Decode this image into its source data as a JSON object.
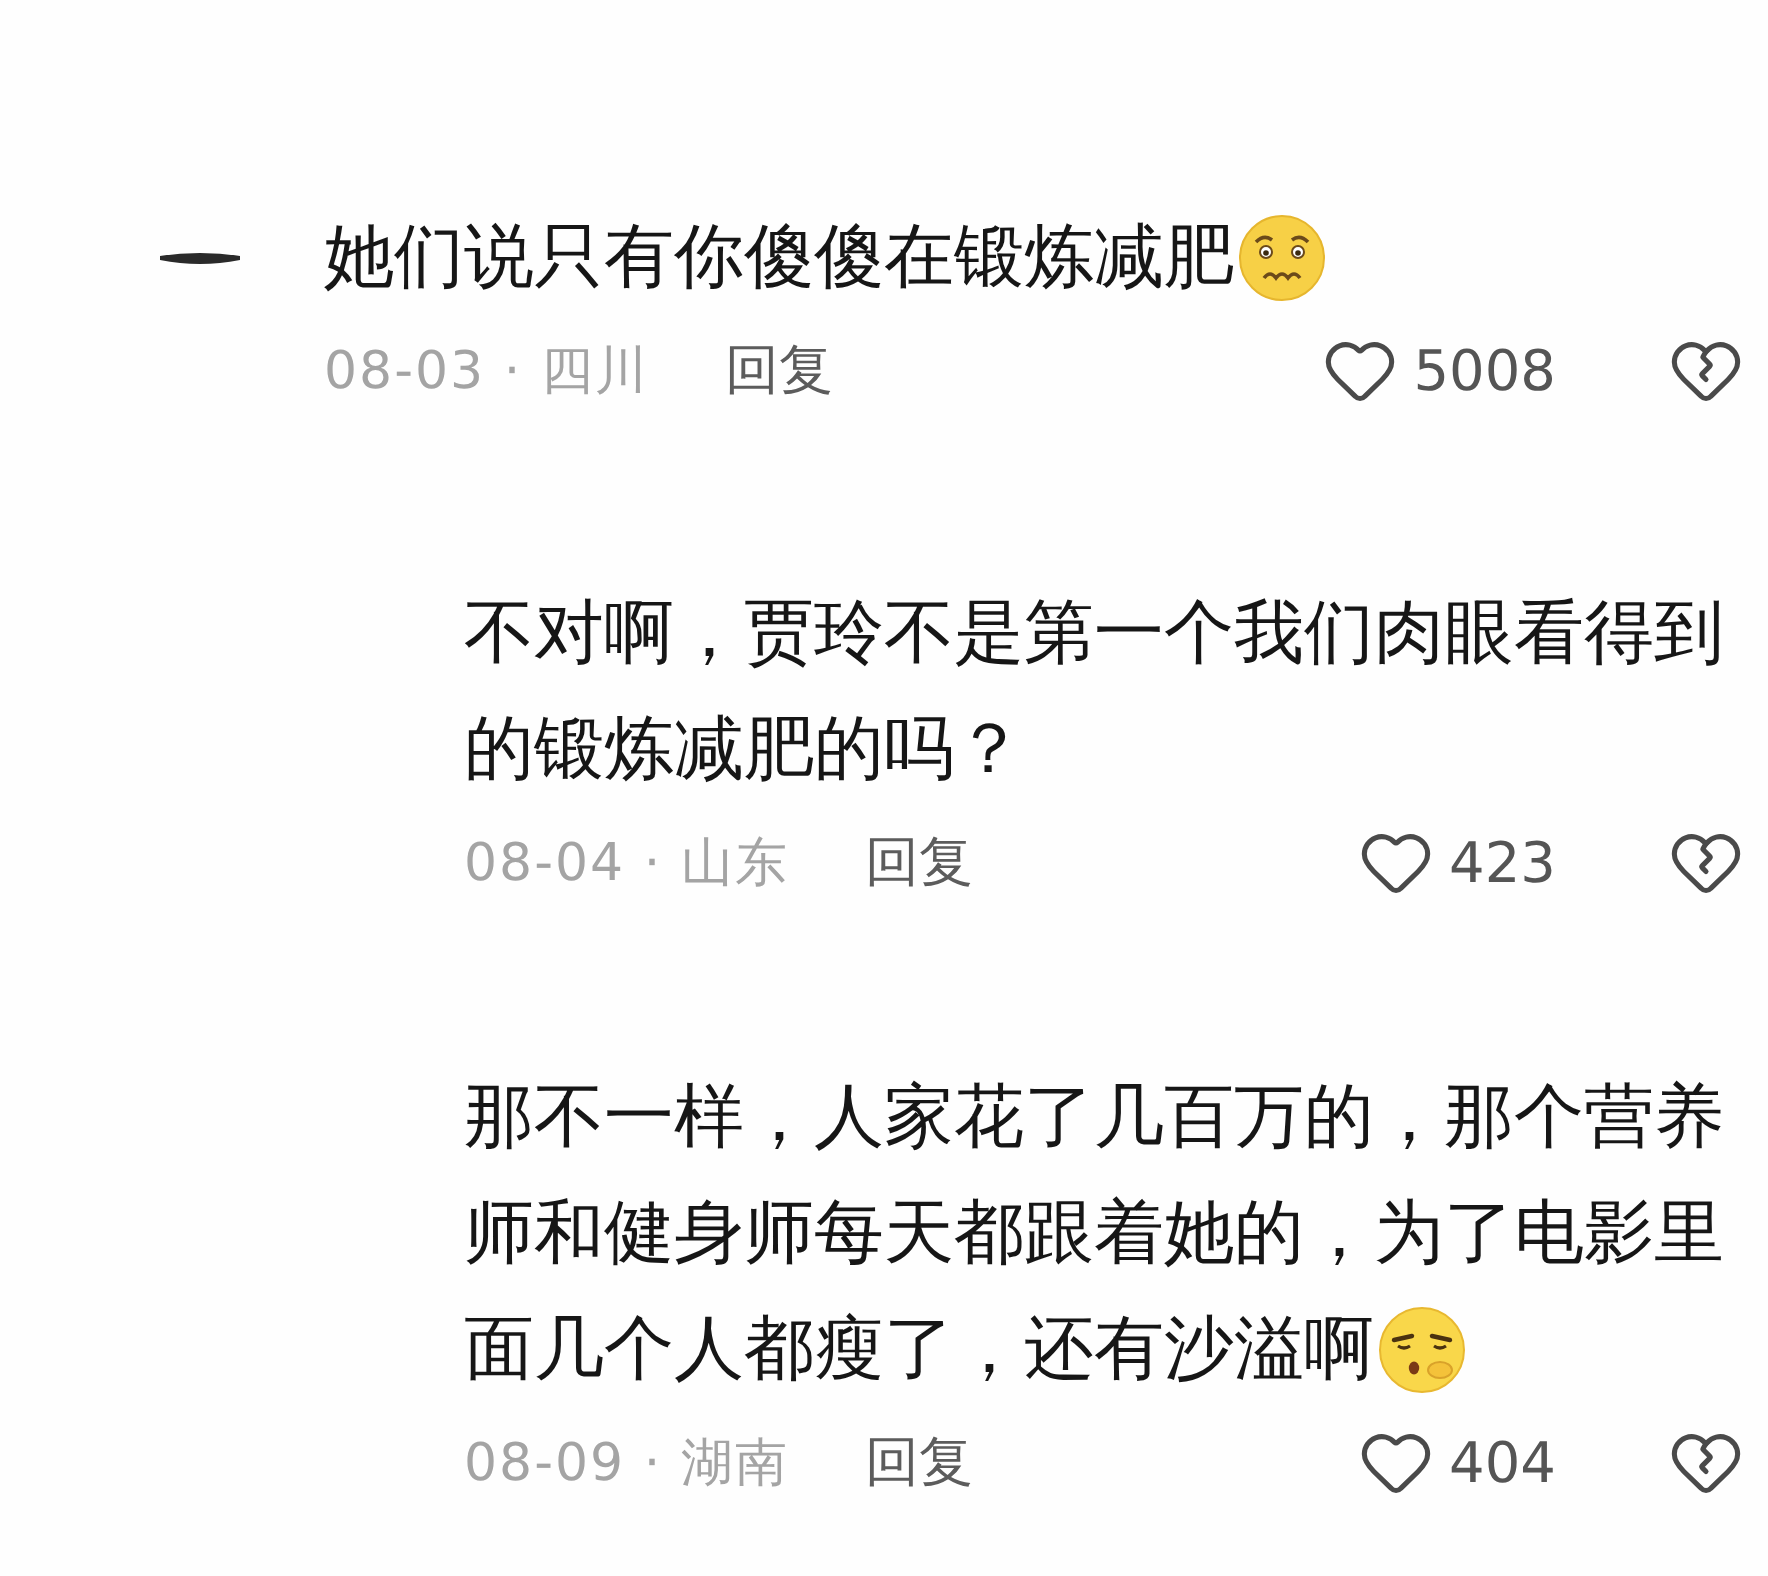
{
  "comments": [
    {
      "lines": [
        "她们说只有你傻傻在锻炼减肥"
      ],
      "emoji": {
        "kind": "worried"
      },
      "meta": "08-03 · 四川",
      "reply_label": "回复",
      "likes": "5008",
      "replies": [
        {
          "lines": [
            "不对啊，贾玲不是第一个我们肉眼看得到",
            "的锻炼减肥的吗？"
          ],
          "meta": "08-04 · 山东",
          "reply_label": "回复",
          "likes": "423"
        },
        {
          "lines": [
            "那不一样，人家花了几百万的，那个营养",
            "师和健身师每天都跟着她的，为了电影里",
            "面几个人都瘦了，还有沙溢啊"
          ],
          "emoji": {
            "kind": "sleepy"
          },
          "meta": "08-09 · 湖南",
          "reply_label": "回复",
          "likes": "404"
        }
      ]
    }
  ]
}
